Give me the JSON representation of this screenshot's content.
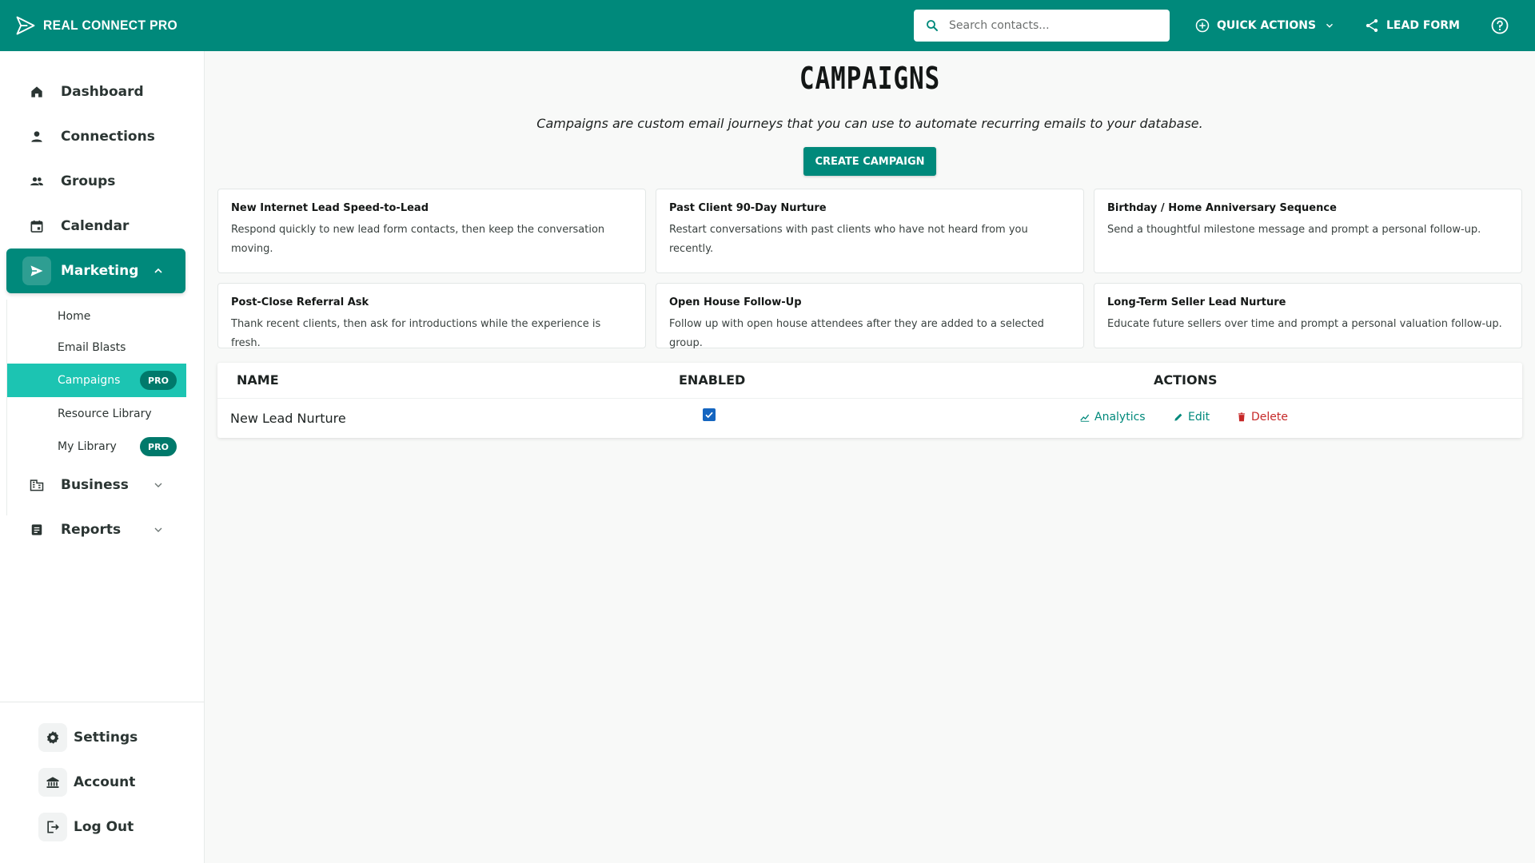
{
  "app": {
    "name": "REAL CONNECT PRO"
  },
  "topbar": {
    "search_placeholder": "Search contacts...",
    "quick_actions_label": "QUICK ACTIONS",
    "lead_form_label": "LEAD FORM"
  },
  "sidebar": {
    "items": [
      {
        "label": "Dashboard",
        "icon": "home-icon"
      },
      {
        "label": "Connections",
        "icon": "person-icon"
      },
      {
        "label": "Groups",
        "icon": "group-icon"
      },
      {
        "label": "Calendar",
        "icon": "calendar-icon"
      },
      {
        "label": "Marketing",
        "icon": "send-icon"
      },
      {
        "label": "Business",
        "icon": "building-icon"
      },
      {
        "label": "Reports",
        "icon": "report-icon"
      }
    ],
    "marketing_sub": [
      {
        "label": "Home"
      },
      {
        "label": "Email Blasts"
      },
      {
        "label": "Campaigns",
        "badge": "PRO"
      },
      {
        "label": "Resource Library"
      },
      {
        "label": "My Library",
        "badge": "PRO"
      }
    ],
    "footer": [
      {
        "label": "Settings",
        "icon": "gear-icon"
      },
      {
        "label": "Account",
        "icon": "bank-icon"
      },
      {
        "label": "Log Out",
        "icon": "logout-icon"
      }
    ]
  },
  "main": {
    "title": "CAMPAIGNS",
    "subtitle": "Campaigns are custom email journeys that you can use to automate recurring emails to your database.",
    "create_button": "CREATE CAMPAIGN",
    "templates": [
      {
        "title": "New Internet Lead Speed-to-Lead",
        "desc": "Respond quickly to new lead form contacts, then keep the conversation moving."
      },
      {
        "title": "Past Client 90-Day Nurture",
        "desc": "Restart conversations with past clients who have not heard from you recently."
      },
      {
        "title": "Birthday / Home Anniversary Sequence",
        "desc": "Send a thoughtful milestone message and prompt a personal follow-up."
      },
      {
        "title": "Post-Close Referral Ask",
        "desc": "Thank recent clients, then ask for introductions while the experience is fresh."
      },
      {
        "title": "Open House Follow-Up",
        "desc": "Follow up with open house attendees after they are added to a selected group."
      },
      {
        "title": "Long-Term Seller Lead Nurture",
        "desc": "Educate future sellers over time and prompt a personal valuation follow-up."
      }
    ],
    "table": {
      "headers": {
        "name": "NAME",
        "enabled": "ENABLED",
        "actions": "ACTIONS"
      },
      "rows": [
        {
          "name": "New Lead Nurture",
          "enabled": true
        }
      ],
      "actions": {
        "analytics": "Analytics",
        "edit": "Edit",
        "delete": "Delete"
      }
    }
  },
  "colors": {
    "primary": "#00897b",
    "active_sub": "#1cc4b2",
    "pro_badge": "#00796b",
    "danger": "#c62828",
    "checkbox": "#1565c0"
  }
}
